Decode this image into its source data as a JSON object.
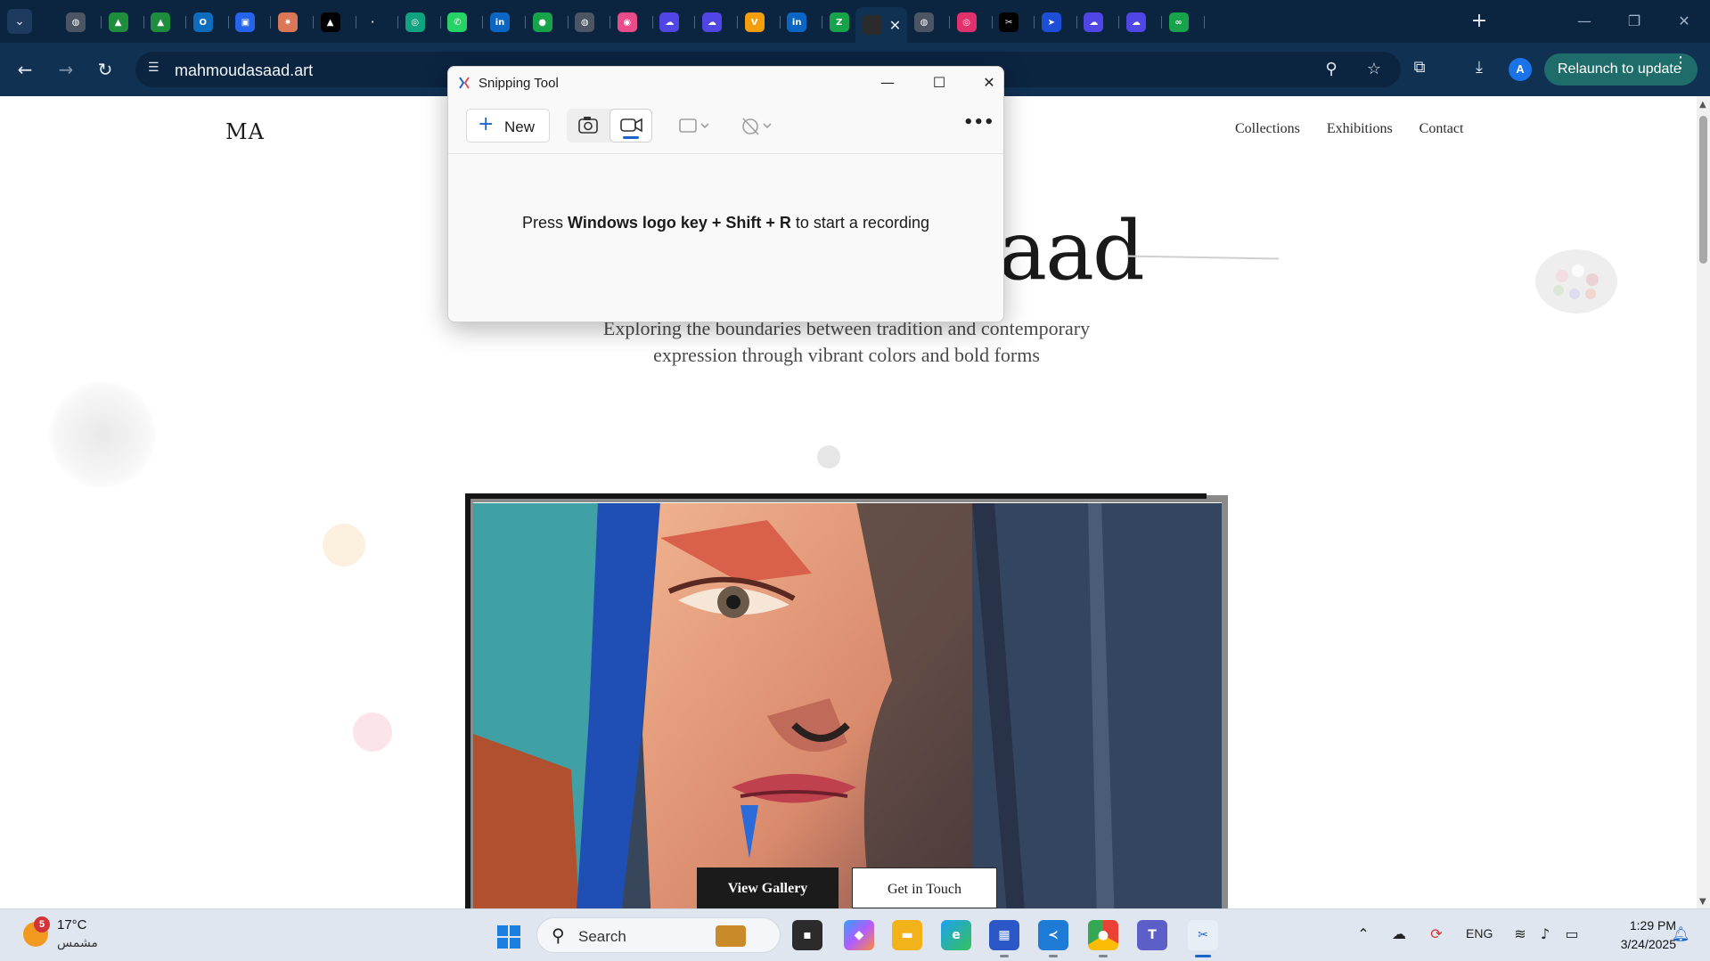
{
  "browser": {
    "tab_search_label": "⌄",
    "tabs": [
      {
        "icon": "generic-globe-icon",
        "color": "#4b5563",
        "glyph": "◍"
      },
      {
        "icon": "drive-icon",
        "color": "#1e8e3e",
        "glyph": "▲"
      },
      {
        "icon": "drive-icon",
        "color": "#1e8e3e",
        "glyph": "▲"
      },
      {
        "icon": "outlook-icon",
        "color": "#0f6cbd",
        "glyph": "O"
      },
      {
        "icon": "teams-board-icon",
        "color": "#2563eb",
        "glyph": "▣"
      },
      {
        "icon": "claude-icon",
        "color": "#d97757",
        "glyph": "✷"
      },
      {
        "icon": "vercel-icon",
        "color": "#000000",
        "glyph": "▲"
      },
      {
        "icon": "loading-icon",
        "color": "#0b2440",
        "glyph": "·"
      },
      {
        "icon": "chatgpt-icon",
        "color": "#10a37f",
        "glyph": "◎"
      },
      {
        "icon": "whatsapp-icon",
        "color": "#25d366",
        "glyph": "✆"
      },
      {
        "icon": "linkedin-icon",
        "color": "#0a66c2",
        "glyph": "in"
      },
      {
        "icon": "green-dot-icon",
        "color": "#16a34a",
        "glyph": "●"
      },
      {
        "icon": "generic-globe-icon",
        "color": "#4b5563",
        "glyph": "◍"
      },
      {
        "icon": "dribbble-icon",
        "color": "#ea4c89",
        "glyph": "◉"
      },
      {
        "icon": "cloud-icon",
        "color": "#4f46e5",
        "glyph": "☁"
      },
      {
        "icon": "cloud-icon",
        "color": "#4f46e5",
        "glyph": "☁"
      },
      {
        "icon": "gemini-icon",
        "color": "#f59e0b",
        "glyph": "V"
      },
      {
        "icon": "linkedin-icon",
        "color": "#0a66c2",
        "glyph": "in"
      },
      {
        "icon": "adobe-icon",
        "color": "#16a34a",
        "glyph": "Z"
      }
    ],
    "active_tab_close": "✕",
    "tabs_right": [
      {
        "icon": "generic-globe-icon",
        "color": "#4b5563",
        "glyph": "◍"
      },
      {
        "icon": "instagram-icon",
        "color": "#e1306c",
        "glyph": "◎"
      },
      {
        "icon": "capcut-icon",
        "color": "#000000",
        "glyph": "✂"
      },
      {
        "icon": "flow-icon",
        "color": "#1d4ed8",
        "glyph": "➤"
      },
      {
        "icon": "cloud-icon",
        "color": "#4f46e5",
        "glyph": "☁"
      },
      {
        "icon": "cloud-icon",
        "color": "#4f46e5",
        "glyph": "☁"
      },
      {
        "icon": "infinity-icon",
        "color": "#16a34a",
        "glyph": "∞"
      }
    ],
    "new_tab": "+",
    "window_controls": {
      "minimize": "—",
      "restore": "❐",
      "close": "✕"
    },
    "nav": {
      "back": "←",
      "forward": "→",
      "reload": "↻"
    },
    "url": "mahmoudasaad.art",
    "relaunch_label": "Relaunch to update",
    "avatar_letter": "A"
  },
  "site": {
    "logo": "MA",
    "nav": [
      "Collections",
      "Exhibitions",
      "Contact"
    ],
    "hero_title_visible": "saad",
    "hero_subtitle_line1": "Exploring the boundaries between tradition and contemporary",
    "hero_subtitle_line2": "expression through vibrant colors and bold forms",
    "btn_gallery": "View Gallery",
    "btn_touch": "Get in Touch"
  },
  "snipping_tool": {
    "title": "Snipping Tool",
    "new_label": "New",
    "hint_prefix": "Press ",
    "hint_keys": "Windows logo key + Shift + R",
    "hint_suffix": " to start a recording"
  },
  "taskbar": {
    "weather_temp": "17°C",
    "weather_condition": "مشمس",
    "weather_badge": "5",
    "search_label": "Search",
    "language": "ENG",
    "time": "1:29 PM",
    "date": "3/24/2025"
  },
  "colors": {
    "chrome_dark": "#0b2440",
    "chrome_toolbar": "#113153",
    "relaunch": "#1f6d6b",
    "accent": "#1a64c8"
  }
}
